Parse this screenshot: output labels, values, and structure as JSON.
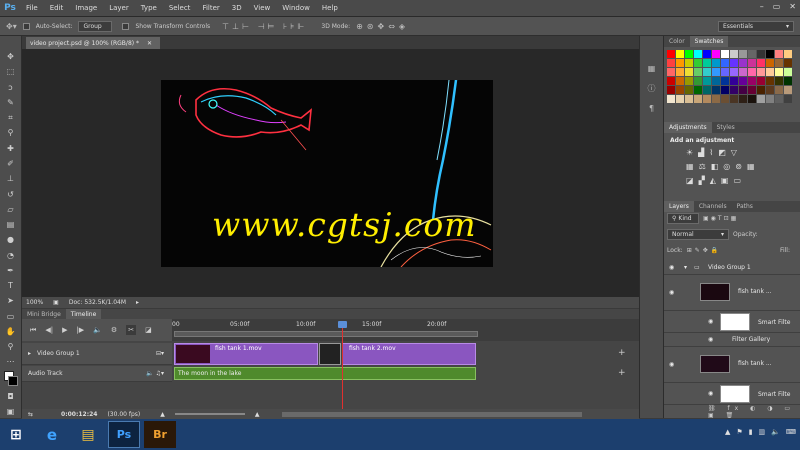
{
  "app": {
    "logo": "Ps"
  },
  "menu": [
    "File",
    "Edit",
    "Image",
    "Layer",
    "Type",
    "Select",
    "Filter",
    "3D",
    "View",
    "Window",
    "Help"
  ],
  "options": {
    "auto_select_label": "Auto-Select:",
    "auto_select_value": "Group",
    "show_transform_label": "Show Transform Controls",
    "mode_3d_label": "3D Mode:",
    "workspace": "Essentials"
  },
  "document": {
    "tab_title": "video project.psd @ 100% (RGB/8) *",
    "watermark": "www.cgtsj.com",
    "zoom": "100%",
    "doc_size": "Doc: 532.5K/1.04M"
  },
  "timeline": {
    "tabs": [
      "Mini Bridge",
      "Timeline"
    ],
    "ruler_labels": [
      "00",
      "05:00f",
      "10:00f",
      "15:00f",
      "20:00f"
    ],
    "tracks": [
      {
        "label": "Video Group 1"
      },
      {
        "label": "Audio Track"
      }
    ],
    "clips": [
      "fish tank 1.mov",
      "fish tank 2.mov"
    ],
    "audio_clip": "The moon in the lake",
    "current_time": "0:00:12:24",
    "fps": "(30.00 fps)"
  },
  "panels": {
    "color_tabs": [
      "Color",
      "Swatches"
    ],
    "adjust_tabs": [
      "Adjustments",
      "Styles"
    ],
    "adjust_title": "Add an adjustment",
    "layers_tabs": [
      "Layers",
      "Channels",
      "Paths"
    ],
    "kind_label": "Kind",
    "blend_mode": "Normal",
    "opacity_label": "Opacity:",
    "lock_label": "Lock:",
    "fill_label": "Fill:",
    "layers": [
      {
        "name": "Video Group 1"
      },
      {
        "name": "fish tank ..."
      },
      {
        "name": "Smart Filte"
      },
      {
        "name": "Filter Gallery"
      },
      {
        "name": "fish tank ..."
      },
      {
        "name": "Smart Filte"
      }
    ]
  },
  "taskbar": {
    "ps_label": "Ps",
    "br_label": "Br"
  },
  "swatch_colors": [
    [
      "#ff0000",
      "#ffff00",
      "#00ff00",
      "#00ffff",
      "#0000ff",
      "#ff00ff",
      "#ffffff",
      "#cccccc",
      "#999999",
      "#666666",
      "#333333",
      "#000000",
      "#ff8080",
      "#ffcc80"
    ],
    [
      "#ff4040",
      "#ff9900",
      "#cccc00",
      "#33cc33",
      "#00cc99",
      "#0099cc",
      "#3366ff",
      "#6633ff",
      "#9933cc",
      "#cc3399",
      "#ff3366",
      "#cc6600",
      "#996633",
      "#663300"
    ],
    [
      "#ff6666",
      "#ffaa33",
      "#eedd33",
      "#66cc66",
      "#33cccc",
      "#3399ff",
      "#6666ff",
      "#9966ff",
      "#cc66cc",
      "#ff66aa",
      "#ff9999",
      "#ffcc99",
      "#ffff99",
      "#ccff99"
    ],
    [
      "#cc0000",
      "#cc6600",
      "#999900",
      "#339933",
      "#009999",
      "#006699",
      "#003399",
      "#330099",
      "#660099",
      "#990066",
      "#990033",
      "#663300",
      "#333300",
      "#003300"
    ],
    [
      "#990000",
      "#994400",
      "#666600",
      "#006600",
      "#006666",
      "#003366",
      "#000066",
      "#330066",
      "#440044",
      "#660033",
      "#4a2200",
      "#5c3a1e",
      "#8a6a4a",
      "#b89a7a"
    ],
    [
      "#f2e6d0",
      "#e6d2b0",
      "#d9be94",
      "#c9a678",
      "#b38a5e",
      "#8c6a46",
      "#6b4f33",
      "#4a3524",
      "#2e2016",
      "#1a120c",
      "#a0a0a0",
      "#808080",
      "#606060",
      "#404040"
    ]
  ]
}
